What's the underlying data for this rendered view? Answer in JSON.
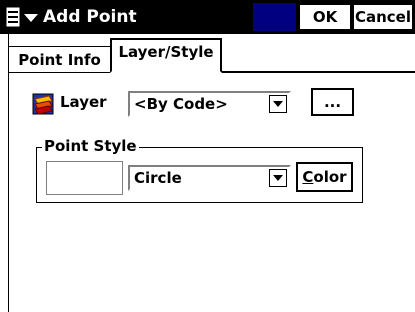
{
  "titlebar": {
    "title": "Add Point",
    "ok_label": "OK",
    "cancel_label": "Cancel",
    "menu_icon": "start-menu-icon"
  },
  "tabs": [
    {
      "label": "Point Info",
      "active": false
    },
    {
      "label": "Layer/Style",
      "active": true
    }
  ],
  "layer": {
    "label": "Layer",
    "icon": "layer-icon",
    "select_value": "<By Code>",
    "browse_label": "..."
  },
  "point_style": {
    "group_label": "Point Style",
    "select_value": "Circle",
    "color_button_first": "C",
    "color_button_rest": "olor"
  },
  "colors": {
    "titlebar_bg": "#000000",
    "title_accent": "#000080"
  }
}
